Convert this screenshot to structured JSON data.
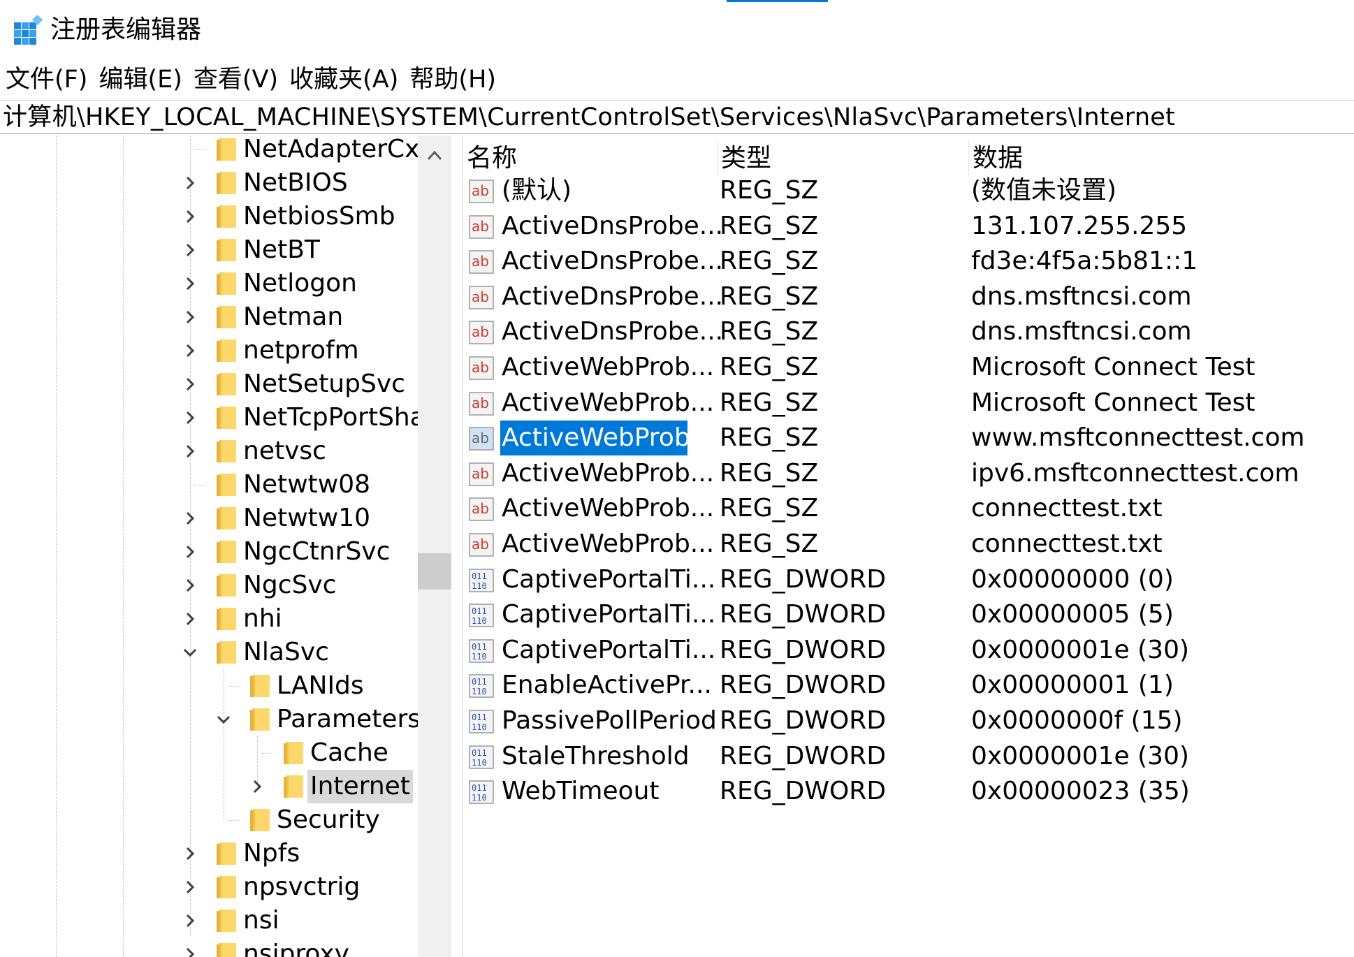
{
  "window": {
    "title": "注册表编辑器",
    "accent_color": "#0078d7",
    "app_icon": "registry-editor-icon"
  },
  "menu": [
    "文件(F)",
    "编辑(E)",
    "查看(V)",
    "收藏夹(A)",
    "帮助(H)"
  ],
  "address_bar": {
    "path": "计算机\\HKEY_LOCAL_MACHINE\\SYSTEM\\CurrentControlSet\\Services\\NlaSvc\\Parameters\\Internet"
  },
  "tree": {
    "items": [
      {
        "label": "NetAdapterCx",
        "level": 0,
        "expander": "none",
        "selected": false
      },
      {
        "label": "NetBIOS",
        "level": 0,
        "expander": "collapsed",
        "selected": false
      },
      {
        "label": "NetbiosSmb",
        "level": 0,
        "expander": "collapsed",
        "selected": false
      },
      {
        "label": "NetBT",
        "level": 0,
        "expander": "collapsed",
        "selected": false
      },
      {
        "label": "Netlogon",
        "level": 0,
        "expander": "collapsed",
        "selected": false
      },
      {
        "label": "Netman",
        "level": 0,
        "expander": "collapsed",
        "selected": false
      },
      {
        "label": "netprofm",
        "level": 0,
        "expander": "collapsed",
        "selected": false
      },
      {
        "label": "NetSetupSvc",
        "level": 0,
        "expander": "collapsed",
        "selected": false
      },
      {
        "label": "NetTcpPortSha",
        "level": 0,
        "expander": "collapsed",
        "selected": false
      },
      {
        "label": "netvsc",
        "level": 0,
        "expander": "collapsed",
        "selected": false
      },
      {
        "label": "Netwtw08",
        "level": 0,
        "expander": "none",
        "selected": false
      },
      {
        "label": "Netwtw10",
        "level": 0,
        "expander": "collapsed",
        "selected": false
      },
      {
        "label": "NgcCtnrSvc",
        "level": 0,
        "expander": "collapsed",
        "selected": false
      },
      {
        "label": "NgcSvc",
        "level": 0,
        "expander": "collapsed",
        "selected": false
      },
      {
        "label": "nhi",
        "level": 0,
        "expander": "collapsed",
        "selected": false
      },
      {
        "label": "NlaSvc",
        "level": 0,
        "expander": "expanded",
        "selected": false
      },
      {
        "label": "LANIds",
        "level": 1,
        "expander": "none",
        "selected": false
      },
      {
        "label": "Parameters",
        "level": 1,
        "expander": "expanded",
        "selected": false
      },
      {
        "label": "Cache",
        "level": 2,
        "expander": "none",
        "selected": false
      },
      {
        "label": "Internet",
        "level": 2,
        "expander": "collapsed",
        "selected": true
      },
      {
        "label": "Security",
        "level": 1,
        "expander": "none",
        "selected": false
      },
      {
        "label": "Npfs",
        "level": 0,
        "expander": "collapsed",
        "selected": false
      },
      {
        "label": "npsvctrig",
        "level": 0,
        "expander": "collapsed",
        "selected": false
      },
      {
        "label": "nsi",
        "level": 0,
        "expander": "collapsed",
        "selected": false
      },
      {
        "label": "nsiproxy",
        "level": 0,
        "expander": "collapsed",
        "selected": false
      }
    ]
  },
  "list": {
    "columns": {
      "name": "名称",
      "type": "类型",
      "data": "数据"
    },
    "rows": [
      {
        "icon": "string-value-icon",
        "name": "(默认)",
        "type": "REG_SZ",
        "data": "(数值未设置)",
        "selected": false
      },
      {
        "icon": "string-value-icon",
        "name": "ActiveDnsProbe...",
        "type": "REG_SZ",
        "data": "131.107.255.255",
        "selected": false
      },
      {
        "icon": "string-value-icon",
        "name": "ActiveDnsProbe...",
        "type": "REG_SZ",
        "data": "fd3e:4f5a:5b81::1",
        "selected": false
      },
      {
        "icon": "string-value-icon",
        "name": "ActiveDnsProbe...",
        "type": "REG_SZ",
        "data": "dns.msftncsi.com",
        "selected": false
      },
      {
        "icon": "string-value-icon",
        "name": "ActiveDnsProbe...",
        "type": "REG_SZ",
        "data": "dns.msftncsi.com",
        "selected": false
      },
      {
        "icon": "string-value-icon",
        "name": "ActiveWebProb...",
        "type": "REG_SZ",
        "data": "Microsoft Connect Test",
        "selected": false
      },
      {
        "icon": "string-value-icon",
        "name": "ActiveWebProb...",
        "type": "REG_SZ",
        "data": "Microsoft Connect Test",
        "selected": false
      },
      {
        "icon": "string-value-icon",
        "name": "ActiveWebProb...",
        "type": "REG_SZ",
        "data": "www.msftconnecttest.com",
        "selected": true
      },
      {
        "icon": "string-value-icon",
        "name": "ActiveWebProb...",
        "type": "REG_SZ",
        "data": "ipv6.msftconnecttest.com",
        "selected": false
      },
      {
        "icon": "string-value-icon",
        "name": "ActiveWebProb...",
        "type": "REG_SZ",
        "data": "connecttest.txt",
        "selected": false
      },
      {
        "icon": "string-value-icon",
        "name": "ActiveWebProb...",
        "type": "REG_SZ",
        "data": "connecttest.txt",
        "selected": false
      },
      {
        "icon": "binary-value-icon",
        "name": "CaptivePortalTi...",
        "type": "REG_DWORD",
        "data": "0x00000000 (0)",
        "selected": false
      },
      {
        "icon": "binary-value-icon",
        "name": "CaptivePortalTi...",
        "type": "REG_DWORD",
        "data": "0x00000005 (5)",
        "selected": false
      },
      {
        "icon": "binary-value-icon",
        "name": "CaptivePortalTi...",
        "type": "REG_DWORD",
        "data": "0x0000001e (30)",
        "selected": false
      },
      {
        "icon": "binary-value-icon",
        "name": "EnableActivePr...",
        "type": "REG_DWORD",
        "data": "0x00000001 (1)",
        "selected": false
      },
      {
        "icon": "binary-value-icon",
        "name": "PassivePollPeriod",
        "type": "REG_DWORD",
        "data": "0x0000000f (15)",
        "selected": false
      },
      {
        "icon": "binary-value-icon",
        "name": "StaleThreshold",
        "type": "REG_DWORD",
        "data": "0x0000001e (30)",
        "selected": false
      },
      {
        "icon": "binary-value-icon",
        "name": "WebTimeout",
        "type": "REG_DWORD",
        "data": "0x00000023 (35)",
        "selected": false
      }
    ]
  }
}
